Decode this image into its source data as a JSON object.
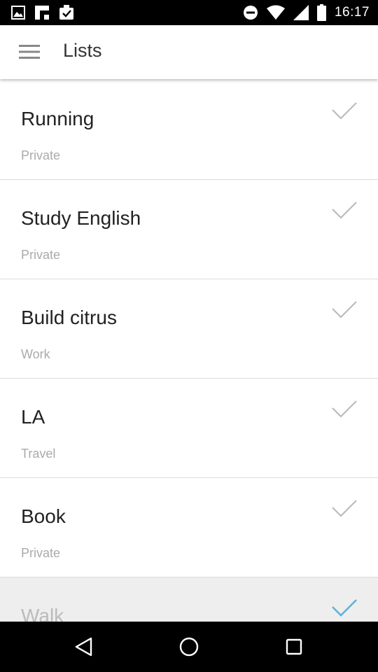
{
  "status_bar": {
    "time": "16:17",
    "left_icons": [
      "image-icon",
      "flipboard-icon",
      "download-box-icon"
    ],
    "right_icons": [
      "do-not-disturb-icon",
      "wifi-icon",
      "signal-icon",
      "battery-icon"
    ]
  },
  "app_bar": {
    "title": "Lists",
    "menu_icon": "hamburger-menu-icon"
  },
  "lists": [
    {
      "title": "Running",
      "category": "Private"
    },
    {
      "title": "Study English",
      "category": "Private"
    },
    {
      "title": "Build citrus",
      "category": "Work"
    },
    {
      "title": "LA",
      "category": "Travel"
    },
    {
      "title": "Book",
      "category": "Private"
    },
    {
      "title": "Walk",
      "category": ""
    }
  ],
  "colors": {
    "check_default": "#bbbbbb",
    "check_active": "#5fb3d6",
    "divider": "#dddddd",
    "status_bar": "#000000"
  },
  "nav_bar": {
    "icons": [
      "back-icon",
      "home-icon",
      "recents-icon"
    ]
  }
}
